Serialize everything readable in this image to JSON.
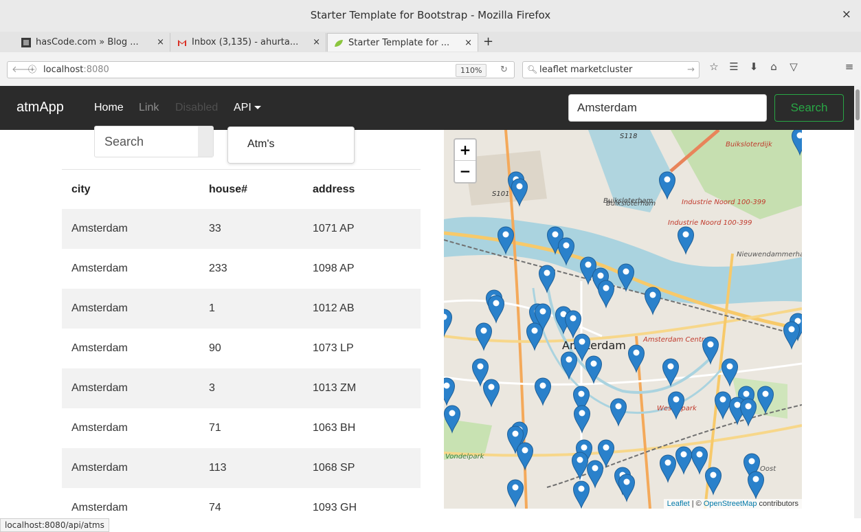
{
  "window": {
    "title": "Starter Template for Bootstrap - Mozilla Firefox",
    "close": "×"
  },
  "tabs": [
    {
      "label": "hasCode.com » Blog ...",
      "close": "×",
      "icon": "hascode-favicon"
    },
    {
      "label": "Inbox (3,135) - ahurta...",
      "close": "×",
      "icon": "gmail-favicon"
    },
    {
      "label": "Starter Template for ...",
      "close": "×",
      "icon": "leaf-favicon"
    }
  ],
  "new_tab": "+",
  "urlbar": {
    "host": "localhost",
    "port": ":8080",
    "zoom": "110%"
  },
  "searchbar": {
    "query": "leaflet marketcluster"
  },
  "app": {
    "brand": "atmApp",
    "nav": {
      "home": "Home",
      "link": "Link",
      "disabled": "Disabled",
      "api": "API"
    },
    "search": {
      "value": "Amsterdam",
      "button": "Search"
    },
    "table_search_placeholder": "Search",
    "dropdown_item": "Atm's"
  },
  "table": {
    "headers": [
      "city",
      "house#",
      "address"
    ],
    "rows": [
      [
        "Amsterdam",
        "33",
        "1071 AP"
      ],
      [
        "Amsterdam",
        "233",
        "1098 AP"
      ],
      [
        "Amsterdam",
        "1",
        "1012 AB"
      ],
      [
        "Amsterdam",
        "90",
        "1073 LP"
      ],
      [
        "Amsterdam",
        "3",
        "1013 ZM"
      ],
      [
        "Amsterdam",
        "71",
        "1063 BH"
      ],
      [
        "Amsterdam",
        "113",
        "1068 SP"
      ],
      [
        "Amsterdam",
        "74",
        "1093 GH"
      ]
    ]
  },
  "map": {
    "zoom_in": "+",
    "zoom_out": "−",
    "attribution": {
      "leaflet": "Leaflet",
      "sep": " | © ",
      "osm": "OpenStreetMap",
      "rest": " contributors"
    },
    "labels": [
      "Buiksloterham",
      "Buiksloterham",
      "Buiksloterdijk",
      "Industrie Noord 100-399",
      "Industrie Noord 100-399",
      "Nieuwendammerham",
      "Amsterdam Centrum",
      "Vondelpark",
      "Westerpark",
      "S118",
      "S101",
      "Oost",
      "Amsterdam"
    ],
    "marker_color": "#2a81cb"
  },
  "status": "localhost:8080/api/atms"
}
